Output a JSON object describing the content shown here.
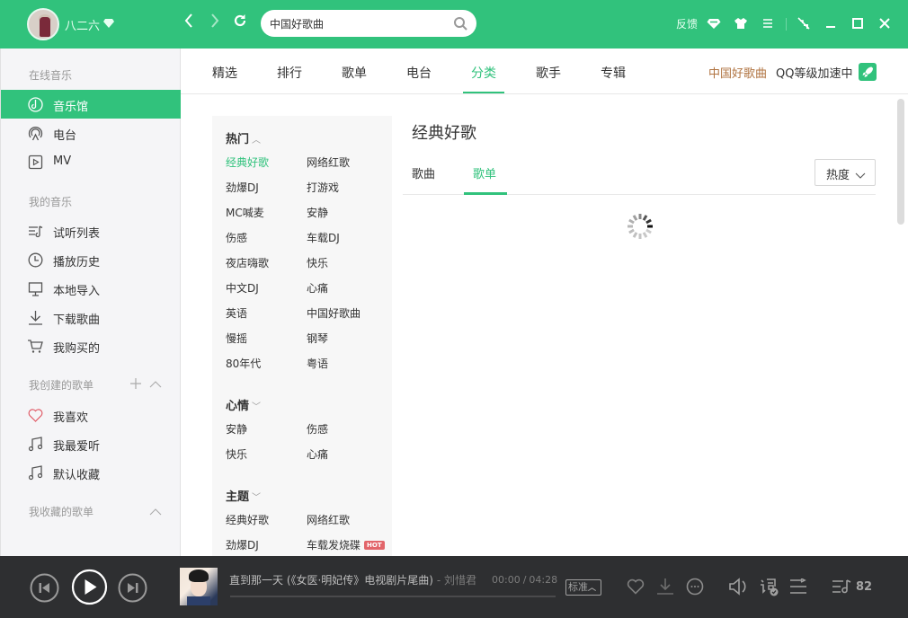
{
  "user": {
    "name": "八二六",
    "vip_icon": "diamond-icon"
  },
  "toolbar": {
    "back_icon": "chevron-left-icon",
    "forward_icon": "chevron-right-icon",
    "refresh_icon": "refresh-icon",
    "search_value": "中国好歌曲",
    "search_icon": "search-icon",
    "feedback_label": "反馈",
    "icons": [
      "diamond-icon",
      "tshirt-skin-icon",
      "menu-icon",
      "mini-mode-icon",
      "minimize-icon",
      "maximize-icon",
      "close-icon"
    ]
  },
  "sidebar": {
    "sections": [
      {
        "title": "在线音乐",
        "items": [
          {
            "label": "音乐馆",
            "icon": "music-hall-icon",
            "active": true
          },
          {
            "label": "电台",
            "icon": "radio-icon"
          },
          {
            "label": "MV",
            "icon": "mv-play-icon"
          }
        ]
      },
      {
        "title": "我的音乐",
        "items": [
          {
            "label": "试听列表",
            "icon": "playlist-icon"
          },
          {
            "label": "播放历史",
            "icon": "clock-icon"
          },
          {
            "label": "本地导入",
            "icon": "monitor-icon"
          },
          {
            "label": "下载歌曲",
            "icon": "download-icon"
          },
          {
            "label": "我购买的",
            "icon": "cart-icon"
          }
        ]
      },
      {
        "title": "我创建的歌单",
        "actions": [
          "plus-icon",
          "chevron-up-icon"
        ],
        "items": [
          {
            "label": "我喜欢",
            "icon": "heart-icon"
          },
          {
            "label": "我最爱听",
            "icon": "music-note-icon"
          },
          {
            "label": "默认收藏",
            "icon": "music-note-icon"
          }
        ]
      },
      {
        "title": "我收藏的歌单",
        "actions": [
          "chevron-up-icon"
        ],
        "items": []
      }
    ]
  },
  "main": {
    "tabs": [
      {
        "label": "精选"
      },
      {
        "label": "排行"
      },
      {
        "label": "歌单"
      },
      {
        "label": "电台"
      },
      {
        "label": "分类",
        "active": true
      },
      {
        "label": "歌手"
      },
      {
        "label": "专辑"
      }
    ],
    "promo_link": "中国好歌曲",
    "qq_speed": "QQ等级加速中",
    "categories": [
      {
        "title": "热门",
        "expanded": true,
        "items": [
          {
            "label": "经典好歌",
            "active": true
          },
          {
            "label": "网络红歌"
          },
          {
            "label": "劲爆DJ"
          },
          {
            "label": "打游戏"
          },
          {
            "label": "MC喊麦"
          },
          {
            "label": "安静"
          },
          {
            "label": "伤感"
          },
          {
            "label": "车载DJ"
          },
          {
            "label": "夜店嗨歌"
          },
          {
            "label": "快乐"
          },
          {
            "label": "中文DJ"
          },
          {
            "label": "心痛"
          },
          {
            "label": "英语"
          },
          {
            "label": "中国好歌曲"
          },
          {
            "label": "慢摇"
          },
          {
            "label": "钢琴"
          },
          {
            "label": "80年代"
          },
          {
            "label": "粤语"
          }
        ]
      },
      {
        "title": "心情",
        "expanded": false,
        "items": [
          {
            "label": "安静"
          },
          {
            "label": "伤感"
          },
          {
            "label": "快乐"
          },
          {
            "label": "心痛"
          }
        ]
      },
      {
        "title": "主题",
        "expanded": false,
        "items": [
          {
            "label": "经典好歌"
          },
          {
            "label": "网络红歌"
          },
          {
            "label": "劲爆DJ"
          },
          {
            "label": "车载发烧碟",
            "badge": "HOT"
          }
        ]
      }
    ],
    "content": {
      "title": "经典好歌",
      "sub_tabs": [
        {
          "label": "歌曲"
        },
        {
          "label": "歌单",
          "active": true
        }
      ],
      "sort": {
        "selected": "热度"
      },
      "loading": true
    }
  },
  "player": {
    "song": "直到那一天 (《女医·明妃传》电视剧片尾曲)",
    "artist_sep": " - ",
    "artist": "刘惜君",
    "current_time": "00:00",
    "total_time": "04:28",
    "time_sep": "/",
    "progress": 0,
    "quality": "标准",
    "playlist_count": "82",
    "controls": [
      "prev-icon",
      "play-icon",
      "next-icon"
    ],
    "actions": [
      "heart-icon",
      "download-icon",
      "more-icon",
      "volume-icon",
      "lyrics-icon",
      "play-mode-icon",
      "playlist-icon"
    ]
  },
  "colors": {
    "accent": "#31c27c",
    "promo": "#b07340",
    "hot_badge": "#e2656a",
    "player_bg": "#2e2f31"
  }
}
